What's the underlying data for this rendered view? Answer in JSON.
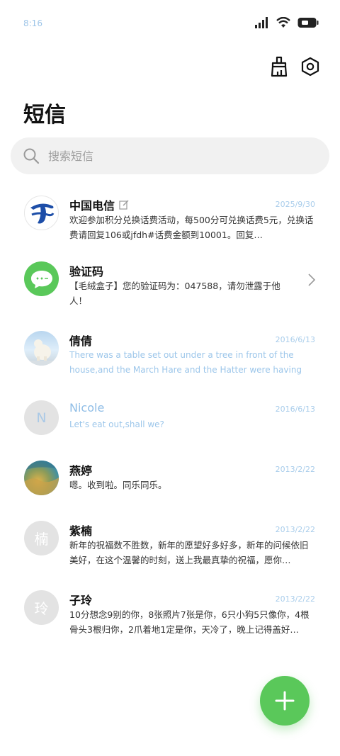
{
  "status": {
    "time": "8:16"
  },
  "page": {
    "title": "短信"
  },
  "search": {
    "placeholder": "搜索短信"
  },
  "conversations": [
    {
      "name": "中国电信",
      "date": "2025/9/30",
      "preview": "欢迎参加积分兑换话费活动，每500分可兑换话费5元，兑换话费请回复106或jfdh#话费金额到10001。回复…",
      "avatar": "china-telecom-logo"
    },
    {
      "name": "验证码",
      "date": "",
      "preview": "【毛绒盒子】您的验证码为：047588，请勿泄露于他人！",
      "avatar": "message-bubble"
    },
    {
      "name": "倩倩",
      "date": "2016/6/13",
      "preview": "There was a table set out under a tree in front of the house,and the March Hare and the Hatter were having tea …",
      "avatar": "polar-bear-photo"
    },
    {
      "name": "Nicole",
      "date": "2016/6/13",
      "preview": "Let's eat out,shall we?",
      "avatar_letter": "N"
    },
    {
      "name": "燕婷",
      "date": "2013/2/22",
      "preview": "嗯。收到啦。同乐同乐。",
      "avatar": "landscape-photo"
    },
    {
      "name": "紫楠",
      "date": "2013/2/22",
      "preview": "新年的祝福数不胜数，新年的愿望好多好多，新年的问候依旧美好，在这个温馨的时刻，送上我最真挚的祝福，愿你…",
      "avatar_letter": "楠"
    },
    {
      "name": "子玲",
      "date": "2013/2/22",
      "preview": "10分想念9别的你，8张照片7张是你，6只小狗5只像你，4根骨头3根归你，2爪着地1定是你，天冷了，晚上记得盖好…",
      "avatar_letter": "玲"
    }
  ],
  "colors": {
    "accent": "#5ac85a",
    "muted_blue": "#a9cdeb"
  }
}
